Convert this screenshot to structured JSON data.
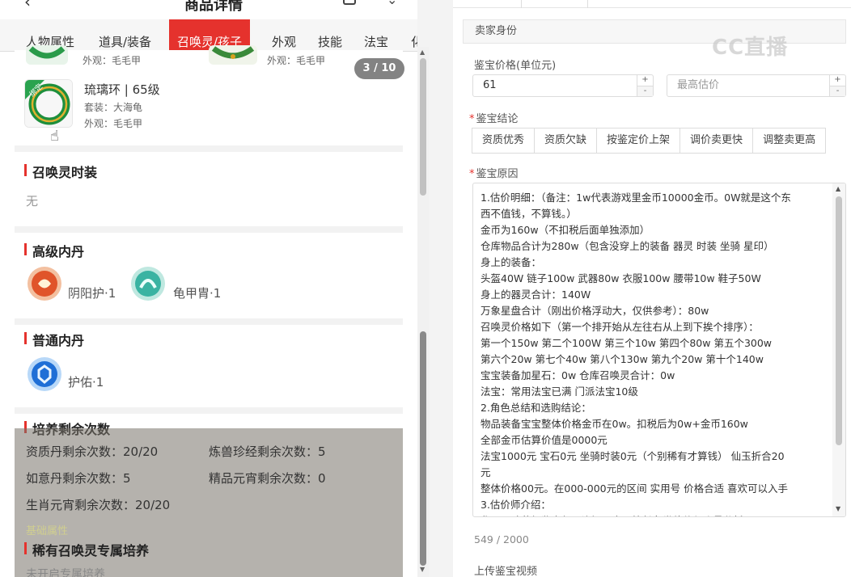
{
  "header": {
    "title": "商品详情",
    "back_icon": "back-arrow-icon"
  },
  "tabs": [
    {
      "label": "人物属性",
      "active": false
    },
    {
      "label": "道具/装备",
      "active": false
    },
    {
      "label": "召唤灵/孩子",
      "active": true
    },
    {
      "label": "外观",
      "active": false
    },
    {
      "label": "技能",
      "active": false
    },
    {
      "label": "法宝",
      "active": false
    },
    {
      "label": "化",
      "active": false
    }
  ],
  "accent_color": "#e5322d",
  "top_items": [
    {
      "appearance": "外观：毛毛甲"
    },
    {
      "appearance": "外观：毛毛甲"
    }
  ],
  "image_counter": "3 / 10",
  "featured_item": {
    "badge": "绑定",
    "name": "琉璃环 | 65级",
    "set": "套装：大海龟",
    "appearance": "外观：毛毛甲"
  },
  "sections": {
    "summon_outfit": {
      "title": "召唤灵时装",
      "value": "无"
    },
    "advanced_core": {
      "title": "高级内丹",
      "items": [
        {
          "label": "阴阳护·1"
        },
        {
          "label": "龟甲胄·1"
        }
      ]
    },
    "normal_core": {
      "title": "普通内丹",
      "items": [
        {
          "label": "护佑·1"
        }
      ]
    },
    "training": {
      "title": "培养剩余次数",
      "stats": [
        "资质丹剩余次数：20/20",
        "炼兽珍经剩余次数：5",
        "如意丹剩余次数：5",
        "精品元宵剩余次数：0",
        "生肖元宵剩余次数：20/20"
      ],
      "faint_label": "基础属性"
    },
    "rare_training": {
      "title": "稀有召唤灵专属培养",
      "value": "未开启专属培养"
    }
  },
  "form": {
    "section_header": "卖家身份",
    "price_label": "鉴宝价格(单位元)",
    "price_value": "61",
    "max_estimate_placeholder": "最高估价",
    "conclusion_label": "鉴宝结论",
    "conclusion_buttons": [
      "资质优秀",
      "资质欠缺",
      "按鉴定价上架",
      "调价卖更快",
      "调整卖更高"
    ],
    "reason_label": "鉴宝原因",
    "reason_lines": [
      "1.估价明细：（备注：1w代表游戏里金币10000金币。0W就是这个东",
      "西不值钱，不算钱。）",
      "金币为160w（不扣税后面单独添加）",
      "仓库物品合计为280w（包含没穿上的装备 器灵 时装 坐骑 星印）",
      "身上的装备：",
      "头盔40W 链子100w 武器80w 衣服100w 腰带10w 鞋子50W",
      "身上的器灵合计：140W",
      "万象星盘合计（刚出价格浮动大，仅供参考）：80w",
      "召唤灵价格如下（第一个排开始从左往右从上到下挨个排序）：",
      "第一个150w 第二个100W  第三个10w  第四个80w  第五个300w",
      "第六个20w  第七个40w  第八个130w   第九个20w  第十个140w",
      "宝宝装备加星石：0w      仓库召唤灵合计：0w",
      "法宝：常用法宝已满 门派法宝10级",
      "2.角色总结和选购结论：",
      "物品装备宝宝整体价格金币在0w。扣税后为0w+金币160w",
      "全部金币估算价值是0000元",
      "法宝1000元 宝石0元  坐骑时装0元（个别稀有才算钱） 仙玉折合20",
      "元",
      "整体价格00元。在000-000元的区间 实用号 价格合适 喜欢可以入手",
      "3.估价师介绍：",
      "华远，珍藏级鉴宝师，资深玩家，擅长各类估价与账号分析"
    ],
    "char_count": "549 / 2000",
    "video_label": "上传鉴宝视频"
  },
  "watermark": "CC直播"
}
